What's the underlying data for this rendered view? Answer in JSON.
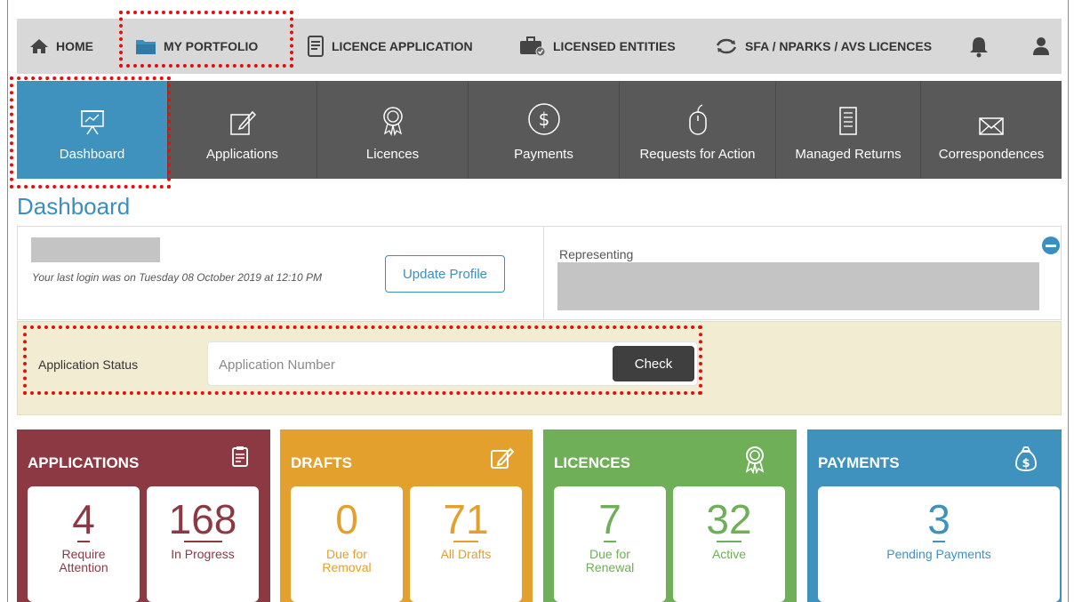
{
  "top_nav": {
    "home": "HOME",
    "my_portfolio": "MY PORTFOLIO",
    "licence_application": "LICENCE APPLICATION",
    "licensed_entities": "LICENSED ENTITIES",
    "sfa_licences": "SFA / NPARKS / AVS LICENCES"
  },
  "tabs": [
    {
      "label": "Dashboard",
      "icon": "presentation-chart-icon",
      "active": true
    },
    {
      "label": "Applications",
      "icon": "edit-pencil-icon"
    },
    {
      "label": "Licences",
      "icon": "award-ribbon-icon"
    },
    {
      "label": "Payments",
      "icon": "dollar-circle-icon"
    },
    {
      "label": "Requests for Action",
      "icon": "mouse-icon"
    },
    {
      "label": "Managed Returns",
      "icon": "document-icon"
    },
    {
      "label": "Correspondences",
      "icon": "envelope-icon"
    }
  ],
  "page_title": "Dashboard",
  "profile": {
    "last_login": "Your last login was on Tuesday 08 October 2019 at 12:10 PM",
    "update_button": "Update Profile",
    "representing_label": "Representing"
  },
  "status": {
    "label": "Application Status",
    "placeholder": "Application Number",
    "check_button": "Check"
  },
  "cards": {
    "applications": {
      "title": "APPLICATIONS",
      "color": "#8d3944",
      "stats": [
        {
          "value": "4",
          "label": "Require Attention"
        },
        {
          "value": "168",
          "label": "In Progress"
        }
      ]
    },
    "drafts": {
      "title": "DRAFTS",
      "color": "#e3a02d",
      "stats": [
        {
          "value": "0",
          "label": "Due for Removal"
        },
        {
          "value": "71",
          "label": "All Drafts"
        }
      ]
    },
    "licences": {
      "title": "LICENCES",
      "color": "#6eaf57",
      "stats": [
        {
          "value": "7",
          "label": "Due for Renewal"
        },
        {
          "value": "32",
          "label": "Active"
        }
      ]
    },
    "payments": {
      "title": "PAYMENTS",
      "color": "#3e92bd",
      "stats": [
        {
          "value": "3",
          "label": "Pending Payments"
        }
      ]
    }
  },
  "colors": {
    "tab_active": "#3f92bd",
    "tab_bg": "#595959",
    "highlight": "#e0100d",
    "title_blue": "#3a8fc1"
  }
}
